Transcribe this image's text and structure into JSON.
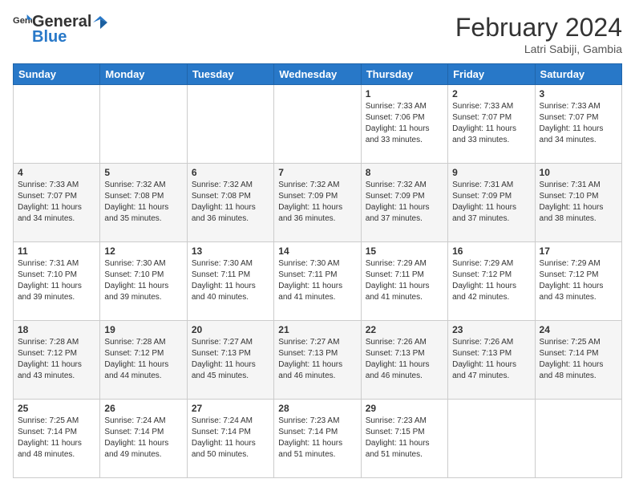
{
  "logo": {
    "general": "General",
    "blue": "Blue"
  },
  "title": "February 2024",
  "subtitle": "Latri Sabiji, Gambia",
  "days_of_week": [
    "Sunday",
    "Monday",
    "Tuesday",
    "Wednesday",
    "Thursday",
    "Friday",
    "Saturday"
  ],
  "weeks": [
    [
      {
        "day": "",
        "info": ""
      },
      {
        "day": "",
        "info": ""
      },
      {
        "day": "",
        "info": ""
      },
      {
        "day": "",
        "info": ""
      },
      {
        "day": "1",
        "info": "Sunrise: 7:33 AM\nSunset: 7:06 PM\nDaylight: 11 hours\nand 33 minutes."
      },
      {
        "day": "2",
        "info": "Sunrise: 7:33 AM\nSunset: 7:07 PM\nDaylight: 11 hours\nand 33 minutes."
      },
      {
        "day": "3",
        "info": "Sunrise: 7:33 AM\nSunset: 7:07 PM\nDaylight: 11 hours\nand 34 minutes."
      }
    ],
    [
      {
        "day": "4",
        "info": "Sunrise: 7:33 AM\nSunset: 7:07 PM\nDaylight: 11 hours\nand 34 minutes."
      },
      {
        "day": "5",
        "info": "Sunrise: 7:32 AM\nSunset: 7:08 PM\nDaylight: 11 hours\nand 35 minutes."
      },
      {
        "day": "6",
        "info": "Sunrise: 7:32 AM\nSunset: 7:08 PM\nDaylight: 11 hours\nand 36 minutes."
      },
      {
        "day": "7",
        "info": "Sunrise: 7:32 AM\nSunset: 7:09 PM\nDaylight: 11 hours\nand 36 minutes."
      },
      {
        "day": "8",
        "info": "Sunrise: 7:32 AM\nSunset: 7:09 PM\nDaylight: 11 hours\nand 37 minutes."
      },
      {
        "day": "9",
        "info": "Sunrise: 7:31 AM\nSunset: 7:09 PM\nDaylight: 11 hours\nand 37 minutes."
      },
      {
        "day": "10",
        "info": "Sunrise: 7:31 AM\nSunset: 7:10 PM\nDaylight: 11 hours\nand 38 minutes."
      }
    ],
    [
      {
        "day": "11",
        "info": "Sunrise: 7:31 AM\nSunset: 7:10 PM\nDaylight: 11 hours\nand 39 minutes."
      },
      {
        "day": "12",
        "info": "Sunrise: 7:30 AM\nSunset: 7:10 PM\nDaylight: 11 hours\nand 39 minutes."
      },
      {
        "day": "13",
        "info": "Sunrise: 7:30 AM\nSunset: 7:11 PM\nDaylight: 11 hours\nand 40 minutes."
      },
      {
        "day": "14",
        "info": "Sunrise: 7:30 AM\nSunset: 7:11 PM\nDaylight: 11 hours\nand 41 minutes."
      },
      {
        "day": "15",
        "info": "Sunrise: 7:29 AM\nSunset: 7:11 PM\nDaylight: 11 hours\nand 41 minutes."
      },
      {
        "day": "16",
        "info": "Sunrise: 7:29 AM\nSunset: 7:12 PM\nDaylight: 11 hours\nand 42 minutes."
      },
      {
        "day": "17",
        "info": "Sunrise: 7:29 AM\nSunset: 7:12 PM\nDaylight: 11 hours\nand 43 minutes."
      }
    ],
    [
      {
        "day": "18",
        "info": "Sunrise: 7:28 AM\nSunset: 7:12 PM\nDaylight: 11 hours\nand 43 minutes."
      },
      {
        "day": "19",
        "info": "Sunrise: 7:28 AM\nSunset: 7:12 PM\nDaylight: 11 hours\nand 44 minutes."
      },
      {
        "day": "20",
        "info": "Sunrise: 7:27 AM\nSunset: 7:13 PM\nDaylight: 11 hours\nand 45 minutes."
      },
      {
        "day": "21",
        "info": "Sunrise: 7:27 AM\nSunset: 7:13 PM\nDaylight: 11 hours\nand 46 minutes."
      },
      {
        "day": "22",
        "info": "Sunrise: 7:26 AM\nSunset: 7:13 PM\nDaylight: 11 hours\nand 46 minutes."
      },
      {
        "day": "23",
        "info": "Sunrise: 7:26 AM\nSunset: 7:13 PM\nDaylight: 11 hours\nand 47 minutes."
      },
      {
        "day": "24",
        "info": "Sunrise: 7:25 AM\nSunset: 7:14 PM\nDaylight: 11 hours\nand 48 minutes."
      }
    ],
    [
      {
        "day": "25",
        "info": "Sunrise: 7:25 AM\nSunset: 7:14 PM\nDaylight: 11 hours\nand 48 minutes."
      },
      {
        "day": "26",
        "info": "Sunrise: 7:24 AM\nSunset: 7:14 PM\nDaylight: 11 hours\nand 49 minutes."
      },
      {
        "day": "27",
        "info": "Sunrise: 7:24 AM\nSunset: 7:14 PM\nDaylight: 11 hours\nand 50 minutes."
      },
      {
        "day": "28",
        "info": "Sunrise: 7:23 AM\nSunset: 7:14 PM\nDaylight: 11 hours\nand 51 minutes."
      },
      {
        "day": "29",
        "info": "Sunrise: 7:23 AM\nSunset: 7:15 PM\nDaylight: 11 hours\nand 51 minutes."
      },
      {
        "day": "",
        "info": ""
      },
      {
        "day": "",
        "info": ""
      }
    ]
  ]
}
